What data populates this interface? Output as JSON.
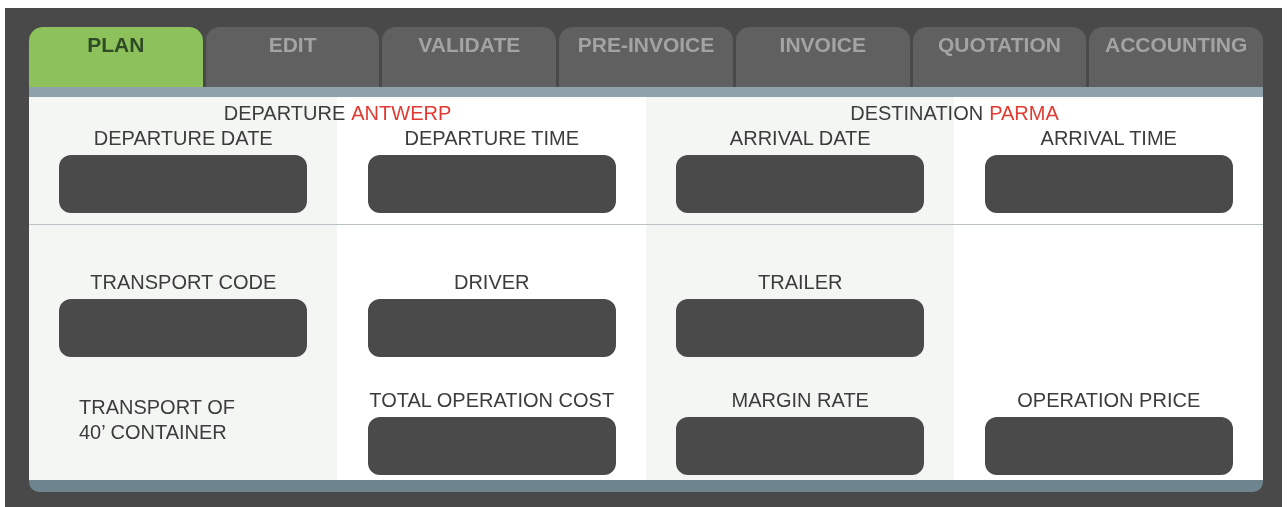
{
  "tabs": [
    {
      "label": "PLAN",
      "selected": true
    },
    {
      "label": "EDIT",
      "selected": false
    },
    {
      "label": "VALIDATE",
      "selected": false
    },
    {
      "label": "PRE-INVOICE",
      "selected": false
    },
    {
      "label": "INVOICE",
      "selected": false
    },
    {
      "label": "QUOTATION",
      "selected": false
    },
    {
      "label": "ACCOUNTING",
      "selected": false
    }
  ],
  "schedule": {
    "departure": {
      "label": "DEPARTURE",
      "place": "ANTWERP"
    },
    "destination": {
      "label": "DESTINATION",
      "place": "PARMA"
    },
    "fields": [
      {
        "label": "DEPARTURE DATE"
      },
      {
        "label": "DEPARTURE TIME"
      },
      {
        "label": "ARRIVAL DATE"
      },
      {
        "label": "ARRIVAL TIME"
      }
    ]
  },
  "details": {
    "rows": [
      [
        {
          "kind": "field",
          "label": "TRANSPORT CODE"
        },
        {
          "kind": "field",
          "label": "DRIVER"
        },
        {
          "kind": "field",
          "label": "TRAILER"
        }
      ],
      [
        {
          "kind": "note",
          "text": "TRANSPORT OF 40’ CONTAINER"
        },
        {
          "kind": "field",
          "label": "TOTAL OPERATION COST"
        },
        {
          "kind": "field",
          "label": "MARGIN RATE"
        },
        {
          "kind": "field",
          "label": "OPERATION PRICE"
        }
      ]
    ]
  }
}
